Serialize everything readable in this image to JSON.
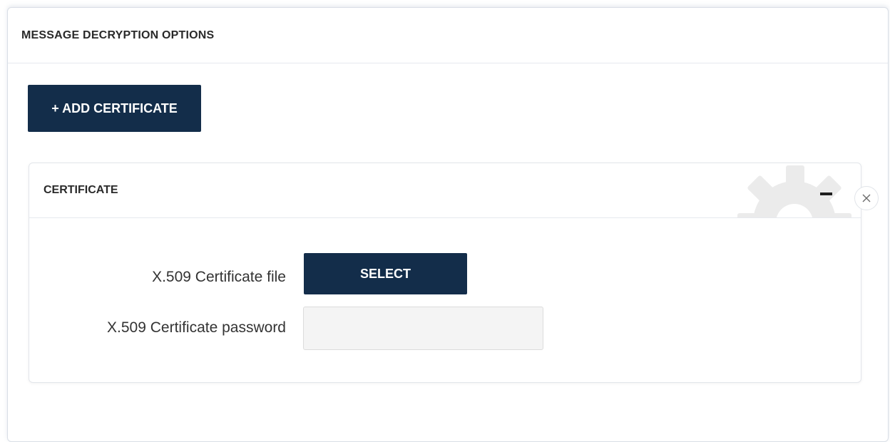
{
  "panel": {
    "title": "MESSAGE DECRYPTION OPTIONS",
    "add_button_label": "+ ADD CERTIFICATE"
  },
  "certificate": {
    "title": "CERTIFICATE",
    "file_label": "X.509 Certificate file",
    "select_button_label": "SELECT",
    "password_label": "X.509 Certificate password",
    "password_value": "",
    "password_placeholder": ""
  },
  "icons": {
    "collapse": "minus-icon",
    "close": "close-icon",
    "watermark": "gear-icon"
  },
  "colors": {
    "primary_button": "#132d4a",
    "input_background": "#f4f4f4"
  }
}
